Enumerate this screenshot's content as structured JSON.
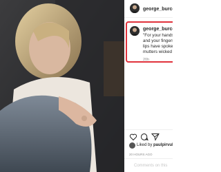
{
  "post": {
    "username": "george_burcea",
    "caption_lines": [
      "\"For your hands ",
      "and your fingers",
      "lips have spoken",
      "mutters wicked"
    ],
    "time": "20h",
    "liked_prefix": "Liked by ",
    "liked_user": "paulpirvul",
    "posted_ago": "20 HOURS AGO",
    "comment_placeholder": "Comments on this",
    "highlight_color": "#e0303a"
  },
  "icons": {
    "like": "heart-icon",
    "comment": "comment-icon",
    "share": "share-icon",
    "save": "bookmark-icon"
  }
}
